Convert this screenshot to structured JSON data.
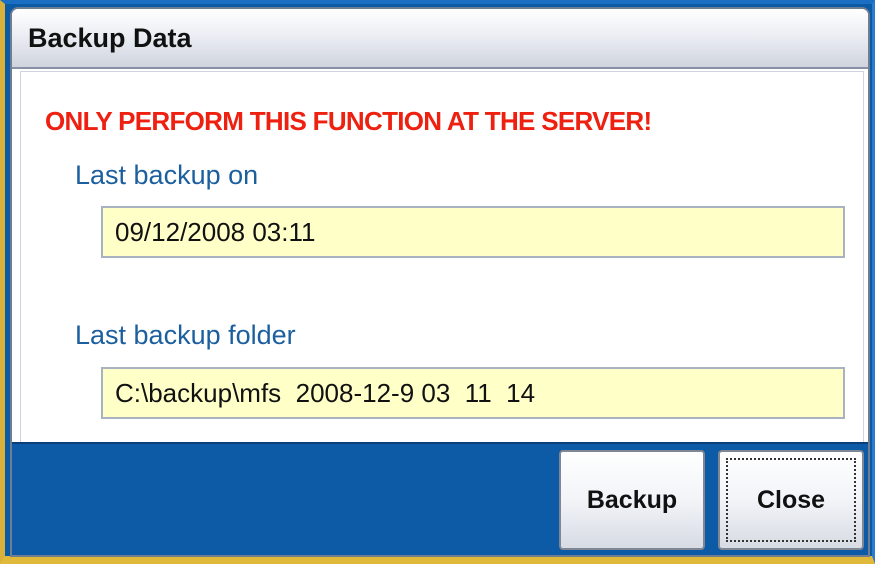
{
  "window": {
    "title": "Backup Data"
  },
  "warning": "ONLY PERFORM THIS FUNCTION AT THE SERVER!",
  "last_backup": {
    "label": "Last backup on",
    "value": "09/12/2008 03:11"
  },
  "last_folder": {
    "label": "Last backup folder",
    "value": "C:\\backup\\mfs  2008-12-9 03  11  14"
  },
  "buttons": {
    "backup": "Backup",
    "close": "Close"
  },
  "colors": {
    "warning": "#ee2010",
    "label": "#1b5f9f",
    "field_bg": "#ffffc8",
    "footer_bg": "#0d5aa7"
  }
}
